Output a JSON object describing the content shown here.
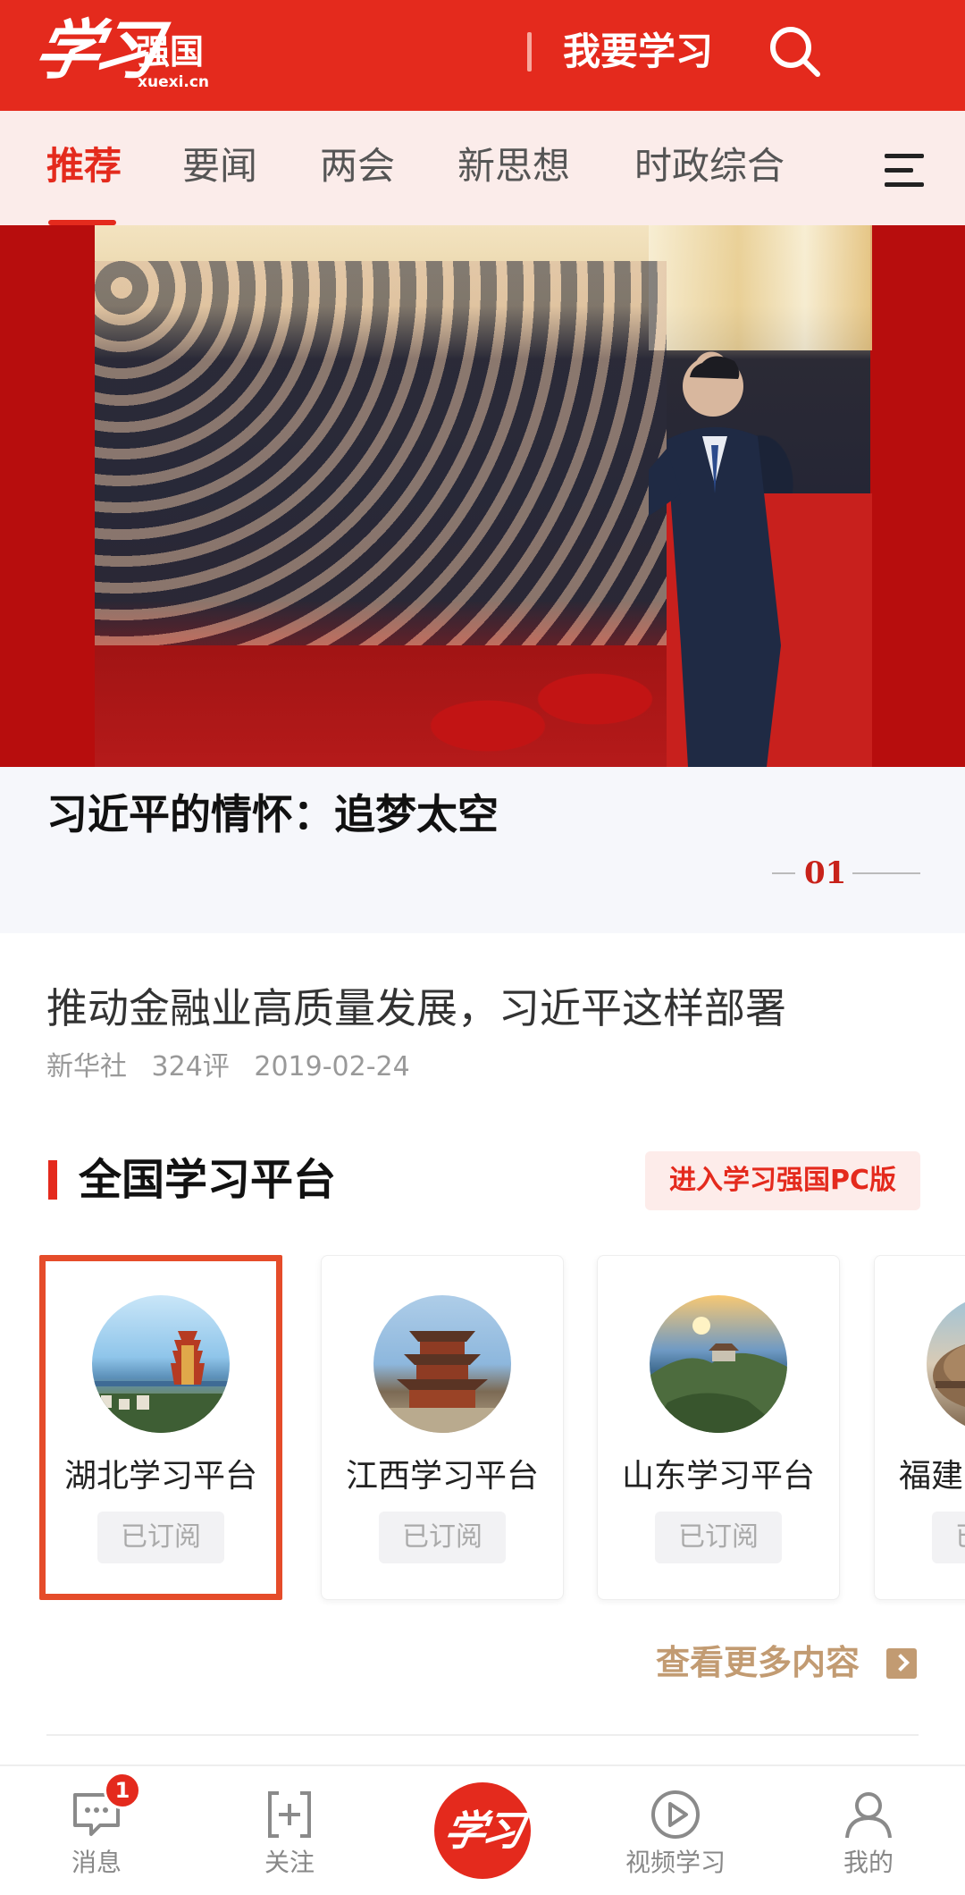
{
  "header": {
    "logo_text": "学习",
    "logo_name": "强国",
    "logo_domain": "xuexi.cn",
    "study_label": "我要学习",
    "search_icon": "search-icon",
    "accent_color": "#e42a1d"
  },
  "tabs": {
    "items": [
      {
        "label": "推荐",
        "active": true
      },
      {
        "label": "要闻",
        "active": false
      },
      {
        "label": "两会",
        "active": false
      },
      {
        "label": "新思想",
        "active": false
      },
      {
        "label": "时政综合",
        "active": false
      }
    ],
    "menu_icon": "hamburger-menu-icon"
  },
  "featured": {
    "title": "习近平的情怀：追梦太空",
    "slide_number": "01"
  },
  "news": {
    "title": "推动金融业高质量发展，习近平这样部署",
    "source": "新华社",
    "comments": "324评",
    "date": "2019-02-24"
  },
  "section": {
    "title": "全国学习平台",
    "pc_button": "进入学习强国PC版",
    "more_label": "查看更多内容"
  },
  "platforms": [
    {
      "name": "湖北学习平台",
      "status": "已订阅",
      "selected": true
    },
    {
      "name": "江西学习平台",
      "status": "已订阅",
      "selected": false
    },
    {
      "name": "山东学习平台",
      "status": "已订阅",
      "selected": false
    },
    {
      "name": "福建学习平台",
      "status": "已订阅",
      "selected": false
    }
  ],
  "bottom_nav": {
    "messages": {
      "label": "消息",
      "badge": "1",
      "icon": "message-icon"
    },
    "follow": {
      "label": "关注",
      "icon": "follow-icon"
    },
    "center_logo": "学习",
    "video": {
      "label": "视频学习",
      "icon": "video-play-icon"
    },
    "mine": {
      "label": "我的",
      "icon": "user-icon"
    }
  }
}
